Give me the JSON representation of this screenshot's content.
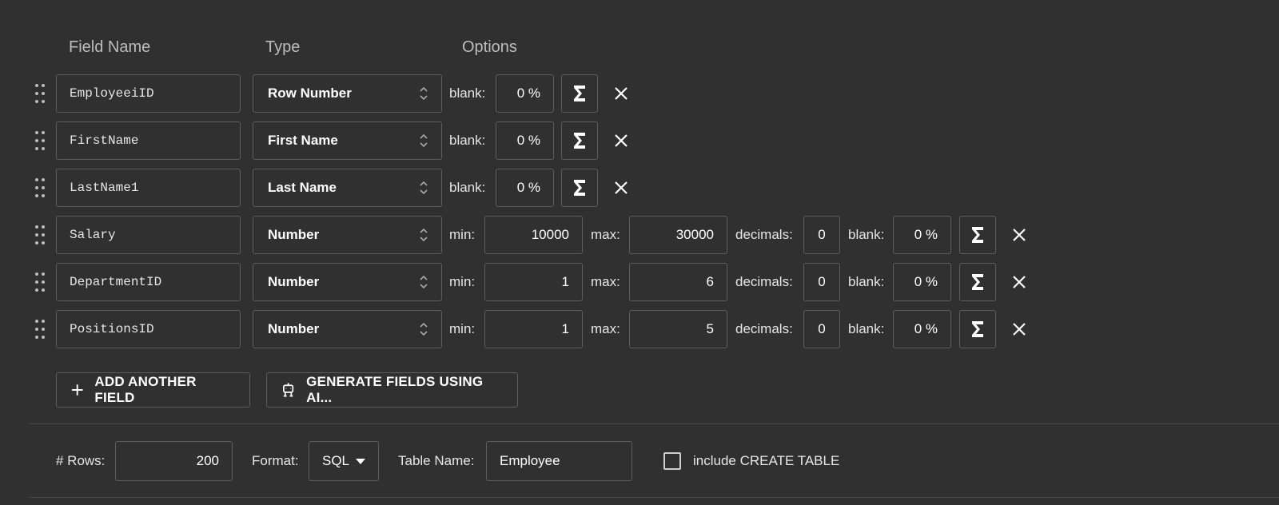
{
  "headers": {
    "field_name": "Field Name",
    "type": "Type",
    "options": "Options"
  },
  "labels": {
    "blank": "blank:",
    "min": "min:",
    "max": "max:",
    "decimals": "decimals:"
  },
  "fields": [
    {
      "name": "EmployeeiID",
      "type": "Row Number",
      "blank": "0 %"
    },
    {
      "name": "FirstName",
      "type": "First Name",
      "blank": "0 %"
    },
    {
      "name": "LastName1",
      "type": "Last Name",
      "blank": "0 %"
    },
    {
      "name": "Salary",
      "type": "Number",
      "min": "10000",
      "max": "30000",
      "decimals": "0",
      "blank": "0 %"
    },
    {
      "name": "DepartmentID",
      "type": "Number",
      "min": "1",
      "max": "6",
      "decimals": "0",
      "blank": "0 %"
    },
    {
      "name": "PositionsID",
      "type": "Number",
      "min": "1",
      "max": "5",
      "decimals": "0",
      "blank": "0 %"
    }
  ],
  "actions": {
    "add_field": "ADD ANOTHER FIELD",
    "generate_ai": "GENERATE FIELDS USING AI..."
  },
  "bottom": {
    "rows_label": "# Rows:",
    "rows_value": "200",
    "format_label": "Format:",
    "format_value": "SQL",
    "table_name_label": "Table Name:",
    "table_name_value": "Employee",
    "create_table_label": "include CREATE TABLE",
    "create_table_checked": false
  },
  "icons": {
    "drag": "drag-handle-icon",
    "sigma": "sigma-icon",
    "close": "close-icon",
    "plus": "plus-icon",
    "robot": "robot-icon",
    "chevron": "chevron-up-down-icon",
    "caret": "caret-down-icon"
  }
}
